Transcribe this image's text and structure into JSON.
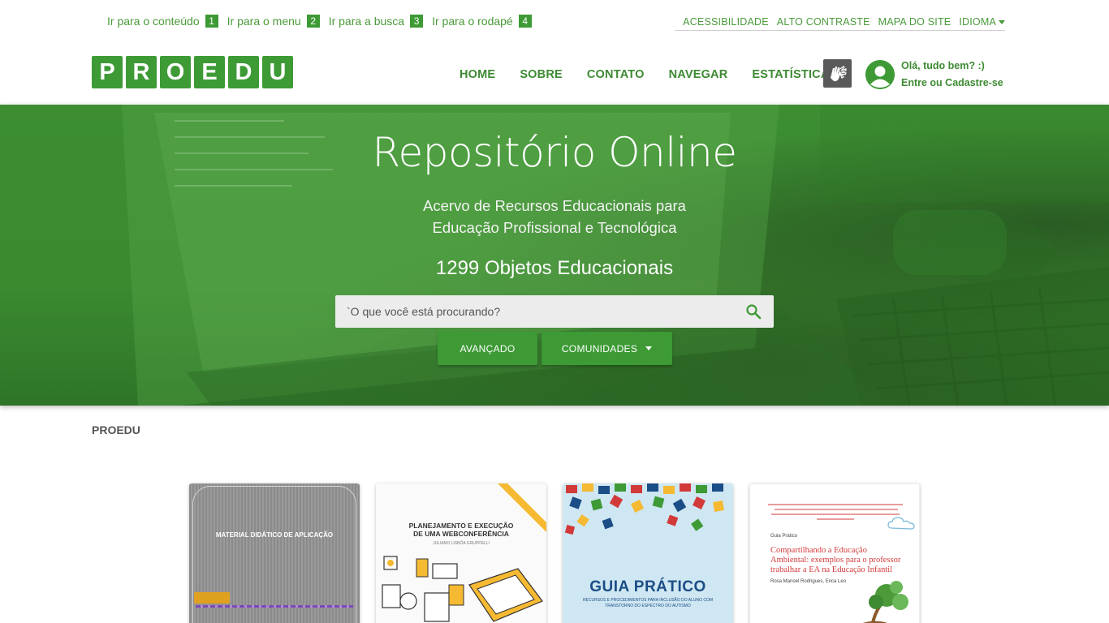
{
  "skip_links": [
    {
      "label": "Ir para o conteúdo",
      "key": "1"
    },
    {
      "label": "Ir para o menu",
      "key": "2"
    },
    {
      "label": "Ir para a busca",
      "key": "3"
    },
    {
      "label": "Ir para o rodapé",
      "key": "4"
    }
  ],
  "accessibility_bar": {
    "accessibility": "ACESSIBILIDADE",
    "high_contrast": "ALTO CONTRASTE",
    "sitemap": "MAPA DO SITE",
    "language": "IDIOMA"
  },
  "logo": {
    "letters": [
      "P",
      "R",
      "O",
      "E",
      "D",
      "U"
    ]
  },
  "nav": {
    "home": "HOME",
    "about": "SOBRE",
    "contact": "CONTATO",
    "browse": "NAVEGAR",
    "statistics": "ESTATÍSTICA"
  },
  "user": {
    "greeting": "Olá, tudo bem? :)",
    "login": "Entre ou Cadastre-se"
  },
  "hero": {
    "title": "Repositório Online",
    "subtitle_line1": "Acervo de Recursos Educacionais para",
    "subtitle_line2": "Educação Profissional e Tecnológica",
    "count": "1299 Objetos Educacionais"
  },
  "search": {
    "placeholder": "`O que você está procurando?"
  },
  "buttons": {
    "advanced": "AVANÇADO",
    "communities": "COMUNIDADES"
  },
  "breadcrumb": "PROEDU",
  "cards": [
    {
      "cover_title": "MATERIAL DIDÁTICO DE APLICAÇÃO"
    },
    {
      "cover_title_line1": "PLANEJAMENTO E EXECUÇÃO",
      "cover_title_line2": "DE UMA WEBCONFERÊNCIA",
      "cover_sub": "JULIANO LISBÔA GRUPPELLI"
    },
    {
      "cover_title": "GUIA PRÁTICO",
      "cover_sub": "RECURSOS E PROCEDIMENTOS PARA INCLUSÃO DO ALUNO COM TRANSTORNO DO ESPECTRO DO AUTISMO"
    },
    {
      "kicker": "Guia Prático",
      "cover_title": "Compartilhando a Educação Ambiental: exemplos para o professor trabalhar a EA na Educação Infantil",
      "author": "Rosa Manoel Rodrigues, Erica Leo"
    }
  ],
  "colors": {
    "brand_green": "#3d9a35",
    "nav_green": "#3d8a32",
    "hero_green": "#3d8e33"
  },
  "icons": {
    "search": "search-icon",
    "libras": "sign-language-icon",
    "user": "user-circle-icon",
    "caret": "chevron-down-icon"
  }
}
